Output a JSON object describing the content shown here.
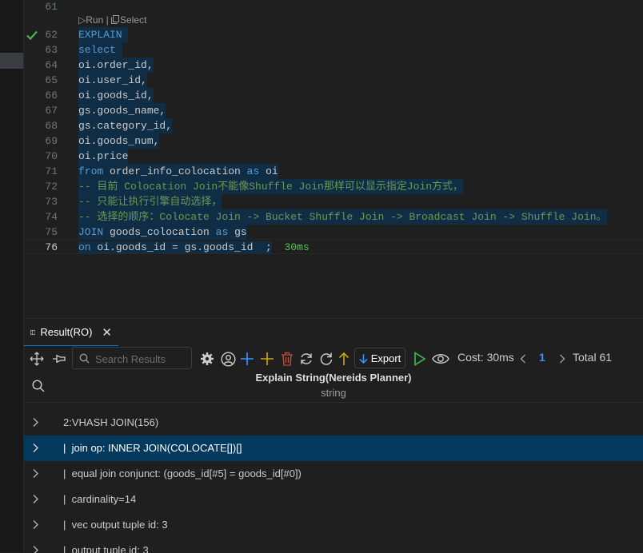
{
  "editor": {
    "codelens": {
      "run": "▷Run",
      "sep": " | ",
      "select": "Select"
    },
    "line_numbers": [
      "61",
      "62",
      "63",
      "64",
      "65",
      "66",
      "67",
      "68",
      "69",
      "70",
      "71",
      "72",
      "73",
      "74",
      "75",
      "76"
    ],
    "lines": [
      "",
      "EXPLAIN ",
      "select ",
      "oi.order_id,",
      "oi.user_id,",
      "oi.goods_id,",
      "gs.goods_name,",
      "gs.category_id,",
      "oi.goods_num,",
      "oi.price",
      "from order_info_colocation as oi",
      "-- 目前 Colocation Join不能像Shuffle Join那样可以显示指定Join方式，",
      "-- 只能让执行引擎自动选择，",
      "-- 选择的顺序：Colocate Join -> Bucket Shuffle Join -> Broadcast Join -> Shuffle Join。",
      "JOIN goods_colocation as gs",
      "on oi.goods_id = gs.goods_id  ;"
    ],
    "cost_inline": "30ms"
  },
  "panel": {
    "tab_label": "Result(RO)",
    "search_placeholder": "Search Results",
    "export_label": "Export",
    "cost_label": "Cost: 30ms",
    "page": "1",
    "total": "Total 61",
    "column_title": "Explain String(Nereids Planner)",
    "column_type": "string",
    "rows": [
      "2:VHASH JOIN(156)",
      "|  join op: INNER JOIN(COLOCATE[])[]",
      "|  equal join conjunct: (goods_id[#5] = goods_id[#0])",
      "|  cardinality=14",
      "|  vec output tuple id: 3",
      "|  output tuple id: 3"
    ],
    "selected_row": 1
  },
  "colors": {
    "keyword": "#569cd6",
    "comment": "#6a9955",
    "accent": "#0078d4",
    "selection": "#04395e",
    "run_green": "#3fb950"
  }
}
